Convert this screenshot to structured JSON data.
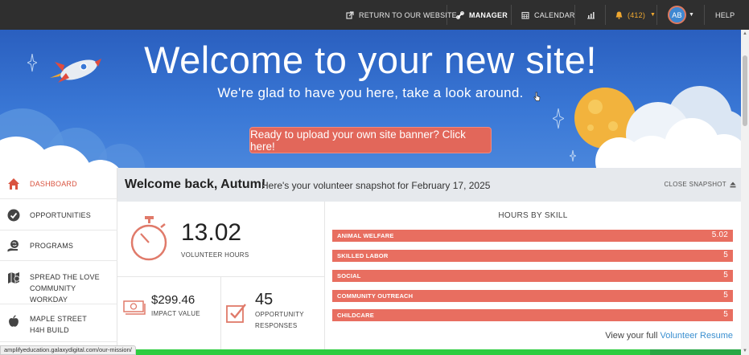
{
  "topbar": {
    "return_label": "RETURN TO OUR WEBSITE",
    "manager_label": "MANAGER",
    "calendar_label": "CALENDAR",
    "notifications_label": "(412)",
    "avatar_initials": "AB",
    "help_label": "HELP"
  },
  "banner": {
    "title": "Welcome to your new site!",
    "subtitle": "We're glad to have you here, take a look around.",
    "cta_label": "Ready to upload your own site banner? Click here!"
  },
  "sidebar": {
    "items": [
      {
        "label": "DASHBOARD",
        "icon": "home-icon"
      },
      {
        "label": "OPPORTUNITIES",
        "icon": "check-circle-icon"
      },
      {
        "label": "PROGRAMS",
        "icon": "globe-hand-icon"
      },
      {
        "label": "SPREAD THE LOVE COMMUNITY WORKDAY",
        "icon": "map-icon"
      },
      {
        "label": "MAPLE STREET H4H BUILD",
        "icon": "apple-icon"
      }
    ]
  },
  "snapshot": {
    "welcome": "Welcome back, Autum!",
    "subtitle": "Here's your volunteer snapshot for February 17, 2025",
    "close_label": "CLOSE SNAPSHOT"
  },
  "stats": {
    "volunteer_hours": "13.02",
    "volunteer_hours_label": "VOLUNTEER HOURS",
    "impact_value": "$299.46",
    "impact_value_label": "IMPACT VALUE",
    "opportunity_responses": "45",
    "opportunity_responses_label_1": "OPPORTUNITY",
    "opportunity_responses_label_2": "RESPONSES"
  },
  "skills": {
    "title": "HOURS BY SKILL",
    "items": [
      {
        "name": "ANIMAL WELFARE",
        "value": "5.02"
      },
      {
        "name": "SKILLED LABOR",
        "value": "5"
      },
      {
        "name": "SOCIAL",
        "value": "5"
      },
      {
        "name": "COMMUNITY OUTREACH",
        "value": "5"
      },
      {
        "name": "CHILDCARE",
        "value": "5"
      }
    ],
    "resume_prefix": "View your full",
    "resume_link": "Volunteer Resume"
  },
  "statusbar": {
    "url": "amplifyeducation.galaxydigital.com/our-mission/"
  },
  "colors": {
    "accent": "#e86e60",
    "banner_blue": "#2a5fbf",
    "topbar": "#2f2f2f",
    "link": "#3a8fd0"
  }
}
